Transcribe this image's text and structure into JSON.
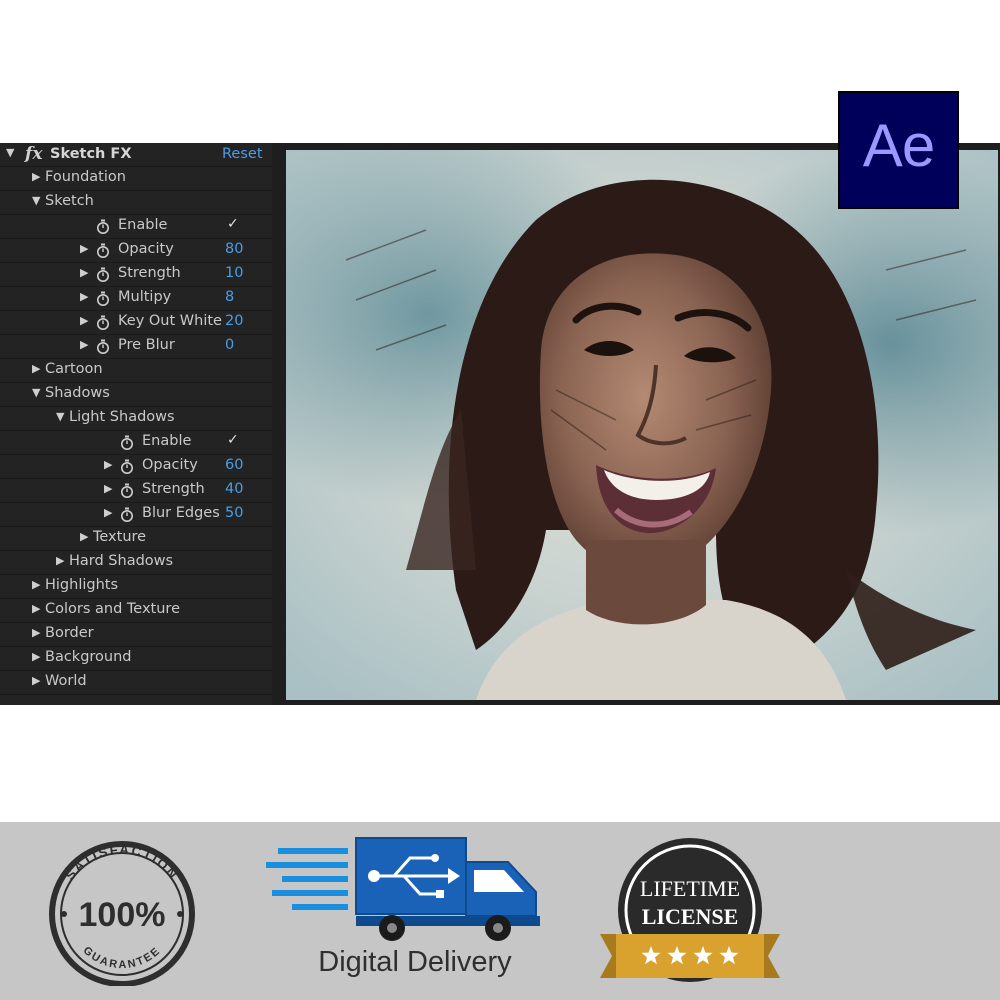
{
  "effect_panel": {
    "fx_glyph": "fx",
    "title": "Sketch FX",
    "reset_label": "Reset",
    "rows": [
      {
        "type": "group",
        "label": "Foundation",
        "expanded": false,
        "level": 0
      },
      {
        "type": "group",
        "label": "Sketch",
        "expanded": true,
        "level": 0
      },
      {
        "type": "param",
        "label": "Enable",
        "checked": true,
        "level": 1
      },
      {
        "type": "param",
        "label": "Opacity",
        "value": "80",
        "level": 1
      },
      {
        "type": "param",
        "label": "Strength",
        "value": "10",
        "level": 1
      },
      {
        "type": "param",
        "label": "Multipy",
        "value": "8",
        "level": 1
      },
      {
        "type": "param",
        "label": "Key Out White",
        "value": "20",
        "level": 1
      },
      {
        "type": "param",
        "label": "Pre Blur",
        "value": "0",
        "level": 1
      },
      {
        "type": "group",
        "label": "Cartoon",
        "expanded": false,
        "level": 0
      },
      {
        "type": "group",
        "label": "Shadows",
        "expanded": true,
        "level": 0
      },
      {
        "type": "group",
        "label": "Light Shadows",
        "expanded": true,
        "level": 1
      },
      {
        "type": "param",
        "label": "Enable",
        "checked": true,
        "level": 2
      },
      {
        "type": "param",
        "label": "Opacity",
        "value": "60",
        "level": 2
      },
      {
        "type": "param",
        "label": "Strength",
        "value": "40",
        "level": 2
      },
      {
        "type": "param",
        "label": "Blur Edges",
        "value": "50",
        "level": 2
      },
      {
        "type": "group",
        "label": "Texture",
        "expanded": false,
        "level": 2
      },
      {
        "type": "group",
        "label": "Hard Shadows",
        "expanded": false,
        "level": 1
      },
      {
        "type": "group",
        "label": "Highlights",
        "expanded": false,
        "level": 0
      },
      {
        "type": "group",
        "label": "Colors and Texture",
        "expanded": false,
        "level": 0
      },
      {
        "type": "group",
        "label": "Border",
        "expanded": false,
        "level": 0
      },
      {
        "type": "group",
        "label": "Background",
        "expanded": false,
        "level": 0
      },
      {
        "type": "group",
        "label": "World",
        "expanded": false,
        "level": 0
      }
    ]
  },
  "ae_badge": {
    "text": "Ae",
    "bg_color": "#00005b",
    "text_color": "#9999ff"
  },
  "badges": {
    "satisfaction": {
      "top_text": "SATISFACTION",
      "center_text": "100%",
      "bottom_text": "GUARANTEE"
    },
    "delivery": {
      "label": "Digital Delivery",
      "icon": "usb-truck-icon",
      "accent": "#1a62b7"
    },
    "lifetime": {
      "line1": "LIFETIME",
      "line2": "LICENSE",
      "stars": 4,
      "ribbon_color": "#d9a22f"
    }
  },
  "colors": {
    "accent_blue": "#4a9ee6",
    "panel_bg": "#232323",
    "band_bg": "#c6c6c6"
  }
}
